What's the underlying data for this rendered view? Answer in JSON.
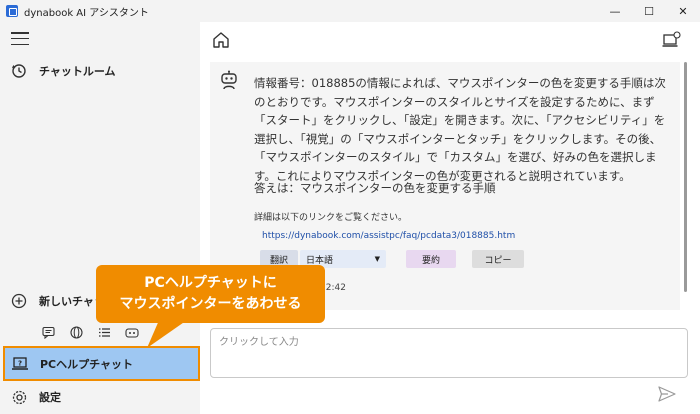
{
  "window": {
    "title": "dynabook AI アシスタント",
    "minimize": "—",
    "maximize": "☐",
    "close": "✕"
  },
  "sidebar": {
    "chat_room": "チャットルーム",
    "new_chat": "新しいチャット",
    "pc_help": "PCヘルプチャット",
    "settings": "設定"
  },
  "chat": {
    "message": "情報番号：018885の情報によれば、マウスポインターの色を変更する手順は次のとおりです。マウスポインターのスタイルとサイズを設定するために、まず「スタート」をクリックし、「設定」を開きます。次に、「アクセシビリティ」を選択し、「視覚」の「マウスポインターとタッチ」をクリックします。その後、「マウスポインターのスタイル」で「カスタム」を選び、好みの色を選択します。これによりマウスポインターの色が変更されると説明されています。",
    "answer": "答えは：マウスポインターの色を変更する手順",
    "detail_intro": "詳細は以下のリンクをご覧ください。",
    "link": "https://dynabook.com/assistpc/faq/pcdata3/018885.htm",
    "translate": "翻訳",
    "language": "日本語",
    "summarize": "要約",
    "copy": "コピー",
    "time": "22:42"
  },
  "input": {
    "placeholder": "クリックして入力"
  },
  "callout": {
    "line1": "PCヘルプチャットに",
    "line2": "マウスポインターをあわせる"
  },
  "colors": {
    "accent": "#f08c00",
    "selected": "#9ec7f2"
  }
}
